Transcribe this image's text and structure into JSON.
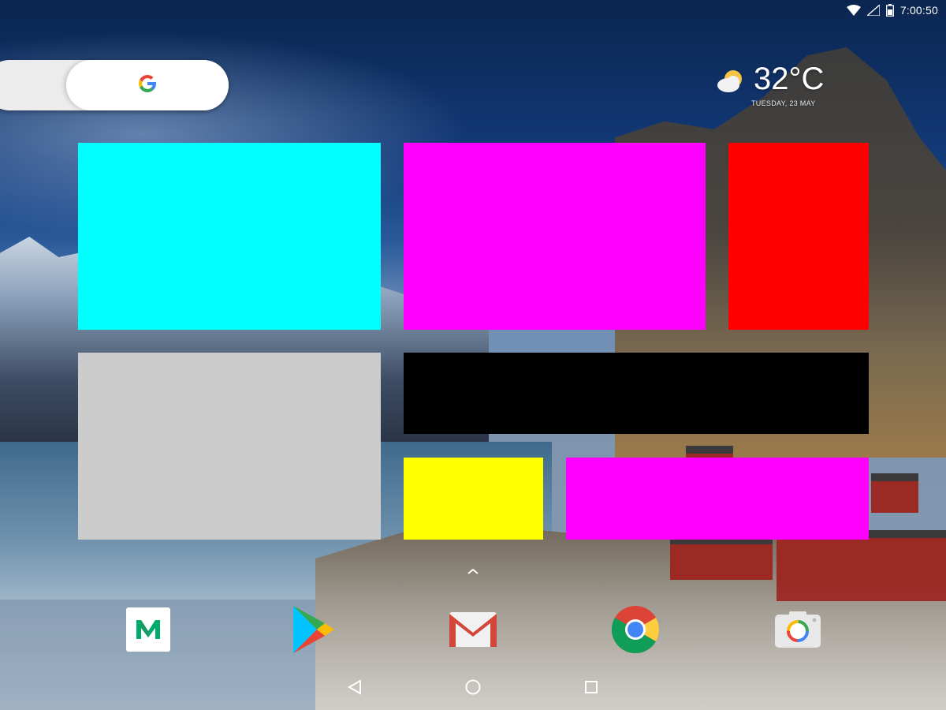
{
  "status_bar": {
    "time": "7:00:50",
    "icons": [
      "wifi-icon",
      "no-signal-icon",
      "battery-icon"
    ]
  },
  "search_widget": {
    "icon": "google-g-icon"
  },
  "weather_widget": {
    "icon": "partly-cloudy-icon",
    "temperature": "32°C",
    "date": "TUESDAY, 23 MAY"
  },
  "widget_blocks": [
    {
      "name": "cyan-block",
      "color": "#00ffff"
    },
    {
      "name": "magenta-block-top",
      "color": "#ff00ff"
    },
    {
      "name": "red-block",
      "color": "#ff0000"
    },
    {
      "name": "gray-block",
      "color": "#cccccc"
    },
    {
      "name": "black-block",
      "color": "#000000"
    },
    {
      "name": "yellow-block",
      "color": "#ffff00"
    },
    {
      "name": "magenta-block-bottom",
      "color": "#ff00ff"
    }
  ],
  "dock": {
    "apps": [
      {
        "name": "medium-app",
        "icon": "medium-icon"
      },
      {
        "name": "play-store-app",
        "icon": "play-store-icon"
      },
      {
        "name": "gmail-app",
        "icon": "gmail-icon"
      },
      {
        "name": "chrome-app",
        "icon": "chrome-icon"
      },
      {
        "name": "camera-app",
        "icon": "camera-icon"
      }
    ]
  },
  "nav_bar": {
    "buttons": [
      "back-icon",
      "home-icon",
      "recents-icon"
    ]
  }
}
